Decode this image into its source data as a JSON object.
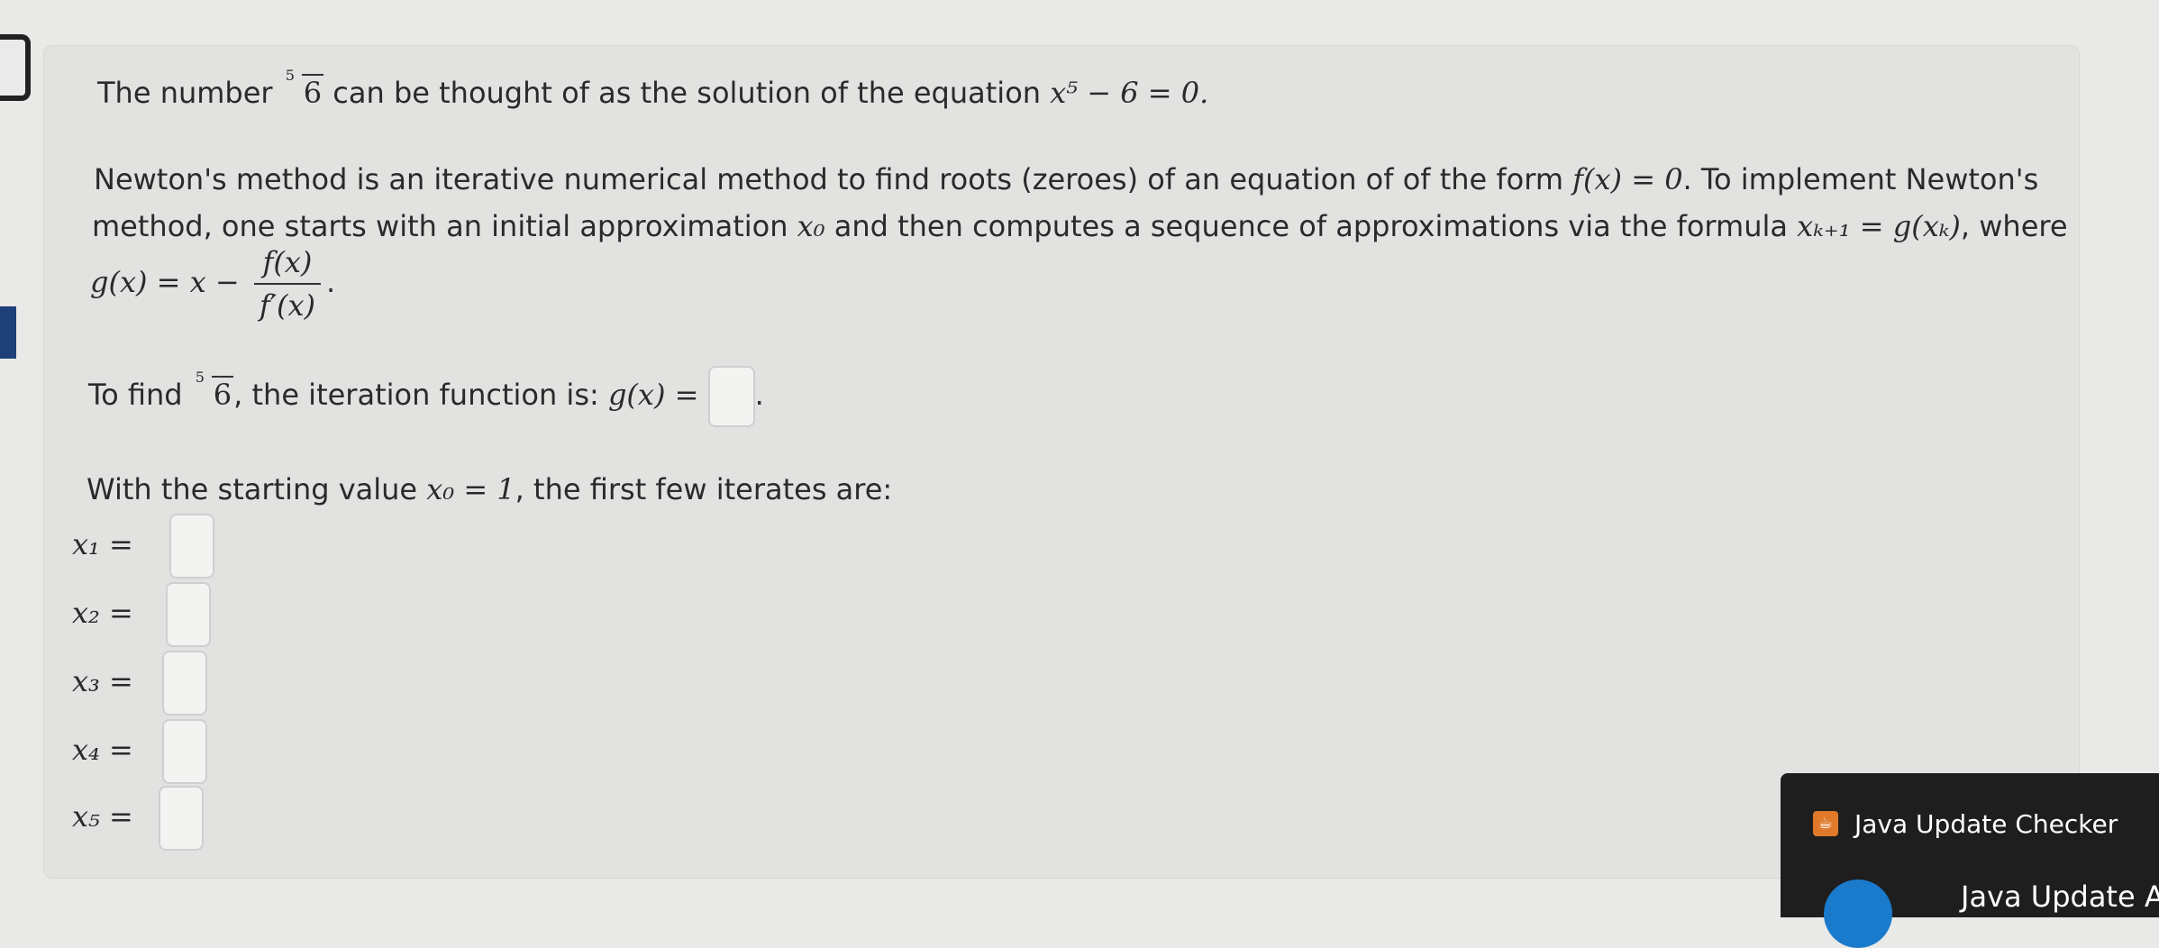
{
  "problem": {
    "intro_prefix": "The number",
    "root_index": "5",
    "root_radicand": "6",
    "intro_suffix": "can be thought of as the solution of the equation",
    "equation": "x⁵ − 6 = 0.",
    "para1_a": "Newton's method is an iterative numerical method to find roots (zeroes) of an equation of of the form",
    "fx_eq": "f(x) = 0",
    "para1_b": ". To implement Newton's",
    "para2_a": "method, one starts with an initial approximation",
    "x0": "x₀",
    "para2_b": "and then computes a sequence of approximations via the formula",
    "formula": "xₖ₊₁ = g(xₖ)",
    "para2_c": ", where",
    "g_lhs": "g(x) = x −",
    "frac_num": "f(x)",
    "frac_den": "f′(x)",
    "g_end": ".",
    "find_prefix": "To find",
    "find_suffix": ", the iteration function is:",
    "g_label": "g(x) =",
    "period": ".",
    "start_text_a": "With the starting value",
    "start_value": "x₀ = 1",
    "start_text_b": ", the first few iterates are:"
  },
  "iterates": [
    {
      "label": "x₁ =",
      "value": ""
    },
    {
      "label": "x₂ =",
      "value": ""
    },
    {
      "label": "x₃ =",
      "value": ""
    },
    {
      "label": "x₄ =",
      "value": ""
    },
    {
      "label": "x₅ =",
      "value": ""
    }
  ],
  "toast": {
    "title": "Java Update Checker",
    "message": "Java Update Ava",
    "icon": "java-icon"
  }
}
